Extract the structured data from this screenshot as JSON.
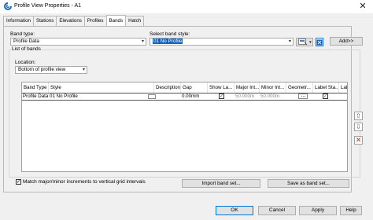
{
  "window": {
    "title": "Profile View Properties - A1"
  },
  "tabs": [
    {
      "label": "Information"
    },
    {
      "label": "Stations"
    },
    {
      "label": "Elevations"
    },
    {
      "label": "Profiles"
    },
    {
      "label": "Bands",
      "active": true
    },
    {
      "label": "Hatch"
    }
  ],
  "band_type": {
    "label": "Band type:",
    "value": "Profile Data"
  },
  "band_style": {
    "label": "Select band style:",
    "value": "01 No Profile"
  },
  "add_button": "Add>>",
  "list_group": {
    "label": "List of bands"
  },
  "location": {
    "label": "Location:",
    "value": "Bottom of profile view"
  },
  "table": {
    "columns": [
      "Band Type",
      "Style",
      "Description",
      "Gap",
      "Show La...",
      "Major Int...",
      "Minor Int...",
      "Geometr...",
      "Label Sta...",
      "Labe"
    ],
    "rows": [
      {
        "band_type": "Profile Data",
        "style": "01 No Profile",
        "description": "",
        "gap": "0.00mm",
        "show_labels": true,
        "major_interval": "50.000m",
        "minor_interval": "50.000m",
        "geometry": "...",
        "label_start": true
      }
    ]
  },
  "side_icons": [
    "move-up-icon",
    "move-down-icon",
    "delete-icon"
  ],
  "match_checkbox": {
    "label": "Match major/minor increments to vertical grid intervals",
    "checked": true
  },
  "import_button": "Import band set...",
  "save_button": "Save as band set...",
  "dialog_buttons": {
    "ok": "OK",
    "cancel": "Cancel",
    "apply": "Apply",
    "help": "Help"
  },
  "colors": {
    "accent": "#0078d7",
    "selection": "#0a64c8",
    "checkbox_check": "#1a7a3a"
  }
}
